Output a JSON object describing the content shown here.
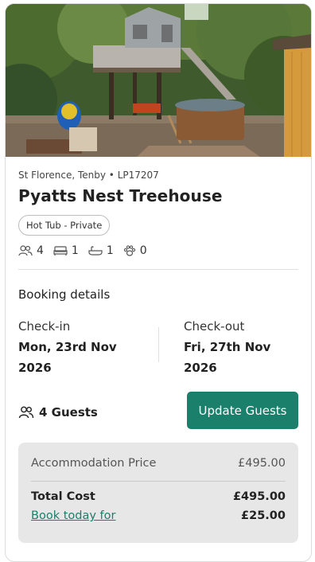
{
  "property": {
    "location": "St Florence, Tenby • LP17207",
    "title": "Pyatts Nest Treehouse",
    "tag": "Hot Tub - Private",
    "amenities": {
      "guests": "4",
      "bedrooms": "1",
      "bathrooms": "1",
      "pets": "0"
    }
  },
  "booking": {
    "heading": "Booking details",
    "checkin_label": "Check-in",
    "checkin_date_line1": "Mon, 23rd Nov",
    "checkin_date_line2": "2026",
    "checkout_label": "Check-out",
    "checkout_date_line1": "Fri, 27th Nov",
    "checkout_date_line2": "2026",
    "guests_text": "4 Guests",
    "update_button": "Update Guests"
  },
  "pricing": {
    "accommodation_label": "Accommodation Price",
    "accommodation_value": "£495.00",
    "total_label": "Total Cost",
    "total_value": "£495.00",
    "deposit_label": "Book today for",
    "deposit_value": "£25.00"
  },
  "colors": {
    "accent": "#1a7f6b",
    "price_box_bg": "#e7e7e7"
  },
  "icons": [
    "people-icon",
    "bed-icon",
    "bath-icon",
    "paw-icon"
  ]
}
